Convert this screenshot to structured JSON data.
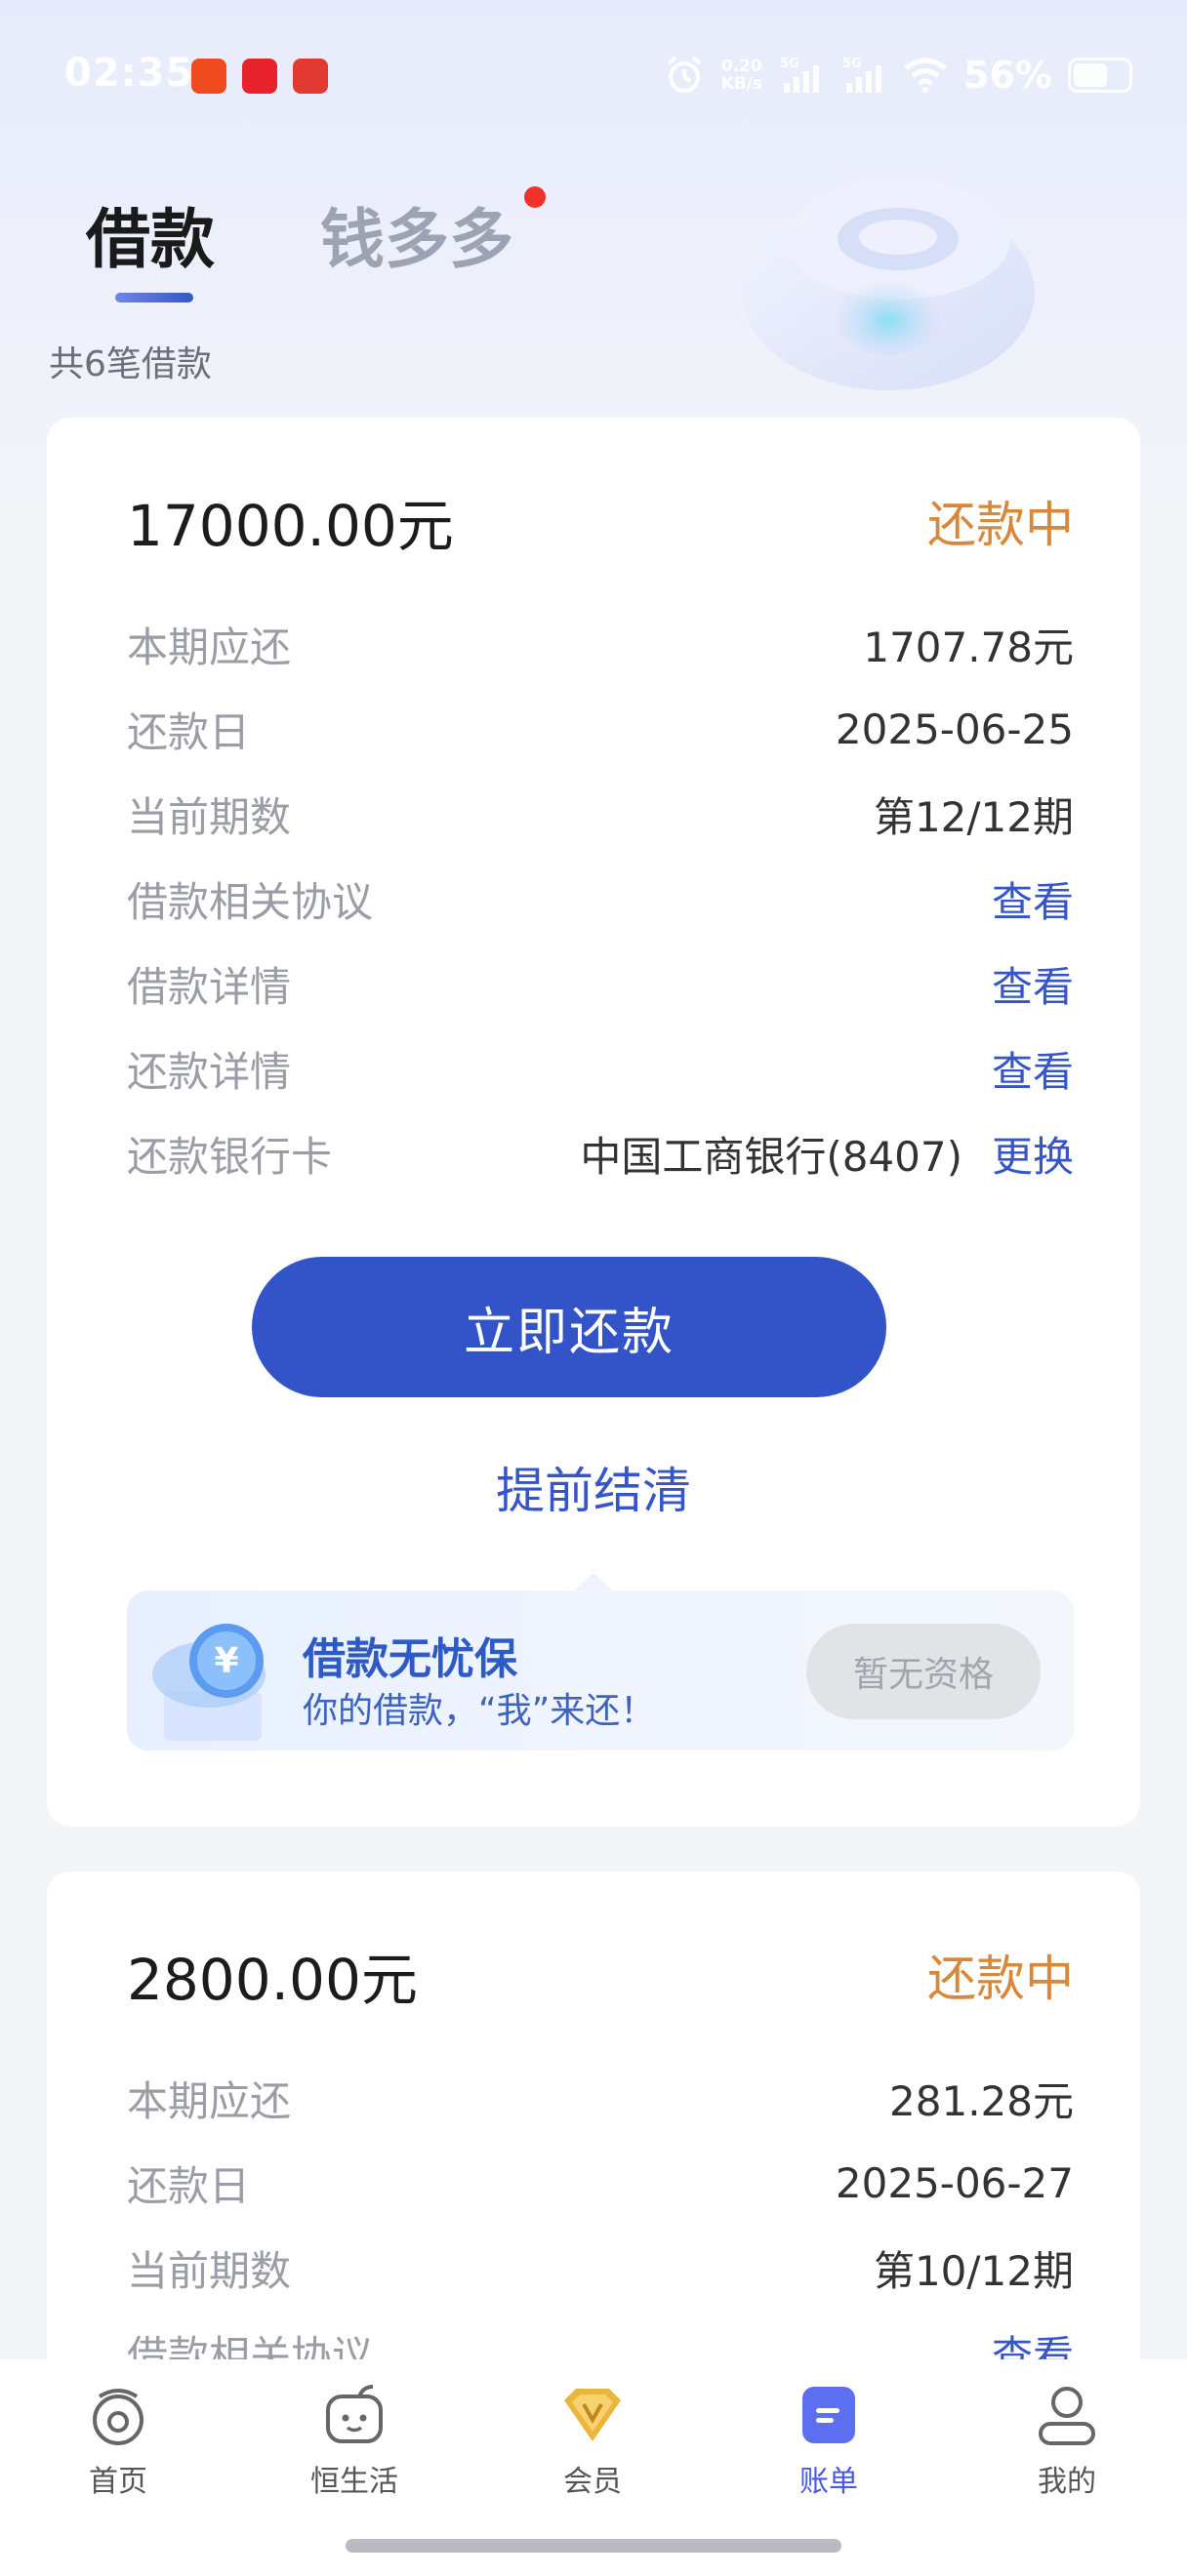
{
  "status_bar": {
    "time": "02:35",
    "net_speed": "0.20",
    "net_unit": "KB/s",
    "sig1": "5G",
    "sig2": "5G",
    "battery": "56%"
  },
  "tabs": [
    {
      "label": "借款",
      "active": true
    },
    {
      "label": "钱多多",
      "active": false,
      "has_badge": true
    }
  ],
  "loan_count_text": "共6笔借款",
  "loans": [
    {
      "amount": "17000.00元",
      "status": "还款中",
      "rows": {
        "due_label": "本期应还",
        "due_value": "1707.78元",
        "date_label": "还款日",
        "date_value": "2025-06-25",
        "period_label": "当前期数",
        "period_value": "第12/12期",
        "agreement_label": "借款相关协议",
        "agreement_link": "查看",
        "detail_label": "借款详情",
        "detail_link": "查看",
        "repay_detail_label": "还款详情",
        "repay_detail_link": "查看",
        "card_label": "还款银行卡",
        "card_value": "中国工商银行(8407)",
        "card_link": "更换"
      },
      "pay_button": "立即还款",
      "early_settle": "提前结清",
      "insurance": {
        "title": "借款无忧保",
        "subtitle": "你的借款，“我”来还！",
        "button": "暂无资格"
      }
    },
    {
      "amount": "2800.00元",
      "status": "还款中",
      "rows": {
        "due_label": "本期应还",
        "due_value": "281.28元",
        "date_label": "还款日",
        "date_value": "2025-06-27",
        "period_label": "当前期数",
        "period_value": "第10/12期",
        "agreement_label": "借款相关协议",
        "agreement_link": "查看"
      }
    }
  ],
  "bottom_nav": [
    {
      "label": "首页",
      "icon": "home-icon"
    },
    {
      "label": "恒生活",
      "icon": "life-icon"
    },
    {
      "label": "会员",
      "icon": "vip-diamond-icon"
    },
    {
      "label": "账单",
      "icon": "bill-icon",
      "active": true
    },
    {
      "label": "我的",
      "icon": "profile-icon"
    }
  ],
  "colors": {
    "accent": "#3354c8",
    "status_orange": "#d8883a",
    "nav_active": "#4a5ae0"
  }
}
